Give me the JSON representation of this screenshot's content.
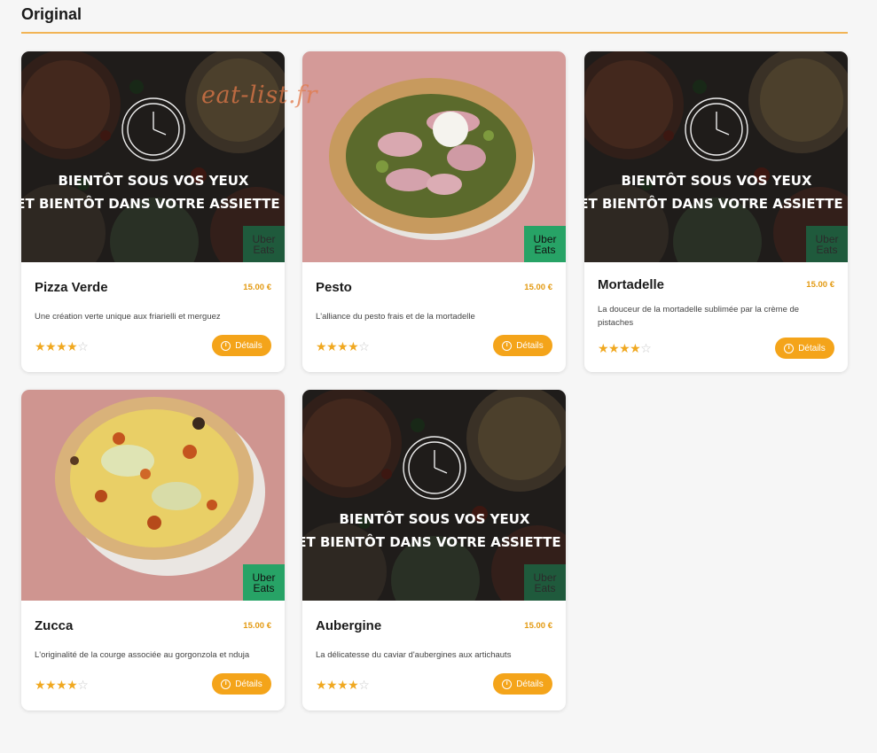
{
  "section": {
    "title": "Original"
  },
  "watermark": "eat-list.fr",
  "uber_label_line1": "Uber",
  "uber_label_line2": "Eats",
  "coming_soon": {
    "line1": "BIENTÔT SOUS VOS YEUX",
    "line2": "ET BIENTÔT DANS VOTRE ASSIETTE !"
  },
  "details_label": "Détails",
  "cards": [
    {
      "name": "Pizza Verde",
      "price": "15.00 €",
      "description": "Une création verte unique aux friarielli et merguez",
      "rating": 4,
      "image": "coming-soon"
    },
    {
      "name": "Pesto",
      "price": "15.00 €",
      "description": "L'alliance du pesto frais et de la mortadelle",
      "rating": 4,
      "image": "pesto-pizza"
    },
    {
      "name": "Mortadelle",
      "price": "15.00 €",
      "description": "La douceur de la mortadelle sublimée par la crème de pistaches",
      "rating": 4,
      "image": "coming-soon"
    },
    {
      "name": "Zucca",
      "price": "15.00 €",
      "description": "L'originalité de la courge associée au gorgonzola et nduja",
      "rating": 4,
      "image": "zucca-pizza"
    },
    {
      "name": "Aubergine",
      "price": "15.00 €",
      "description": "La délicatesse du caviar d'aubergines aux artichauts",
      "rating": 4,
      "image": "coming-soon"
    }
  ],
  "colors": {
    "accent": "#f4a41a",
    "price": "#e39a12",
    "uber_green": "#27a366",
    "rule": "#f2b455"
  }
}
